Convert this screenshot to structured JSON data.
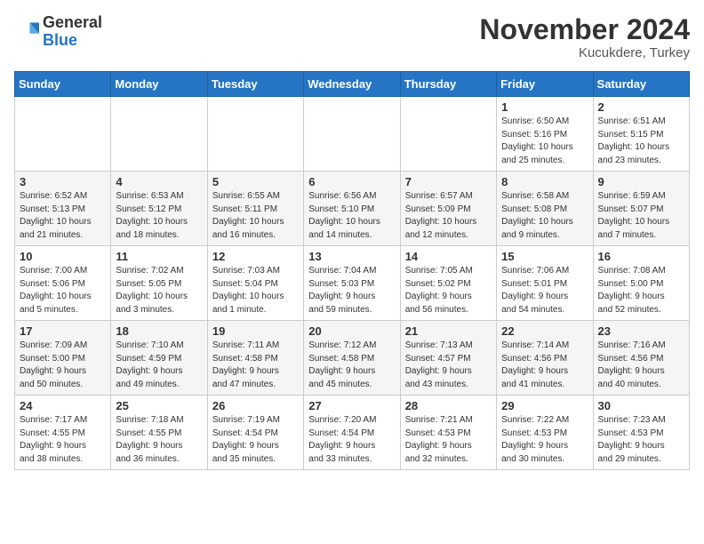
{
  "logo": {
    "general": "General",
    "blue": "Blue"
  },
  "header": {
    "month": "November 2024",
    "location": "Kucukdere, Turkey"
  },
  "days_of_week": [
    "Sunday",
    "Monday",
    "Tuesday",
    "Wednesday",
    "Thursday",
    "Friday",
    "Saturday"
  ],
  "weeks": [
    [
      {
        "day": "",
        "info": ""
      },
      {
        "day": "",
        "info": ""
      },
      {
        "day": "",
        "info": ""
      },
      {
        "day": "",
        "info": ""
      },
      {
        "day": "",
        "info": ""
      },
      {
        "day": "1",
        "info": "Sunrise: 6:50 AM\nSunset: 5:16 PM\nDaylight: 10 hours\nand 25 minutes."
      },
      {
        "day": "2",
        "info": "Sunrise: 6:51 AM\nSunset: 5:15 PM\nDaylight: 10 hours\nand 23 minutes."
      }
    ],
    [
      {
        "day": "3",
        "info": "Sunrise: 6:52 AM\nSunset: 5:13 PM\nDaylight: 10 hours\nand 21 minutes."
      },
      {
        "day": "4",
        "info": "Sunrise: 6:53 AM\nSunset: 5:12 PM\nDaylight: 10 hours\nand 18 minutes."
      },
      {
        "day": "5",
        "info": "Sunrise: 6:55 AM\nSunset: 5:11 PM\nDaylight: 10 hours\nand 16 minutes."
      },
      {
        "day": "6",
        "info": "Sunrise: 6:56 AM\nSunset: 5:10 PM\nDaylight: 10 hours\nand 14 minutes."
      },
      {
        "day": "7",
        "info": "Sunrise: 6:57 AM\nSunset: 5:09 PM\nDaylight: 10 hours\nand 12 minutes."
      },
      {
        "day": "8",
        "info": "Sunrise: 6:58 AM\nSunset: 5:08 PM\nDaylight: 10 hours\nand 9 minutes."
      },
      {
        "day": "9",
        "info": "Sunrise: 6:59 AM\nSunset: 5:07 PM\nDaylight: 10 hours\nand 7 minutes."
      }
    ],
    [
      {
        "day": "10",
        "info": "Sunrise: 7:00 AM\nSunset: 5:06 PM\nDaylight: 10 hours\nand 5 minutes."
      },
      {
        "day": "11",
        "info": "Sunrise: 7:02 AM\nSunset: 5:05 PM\nDaylight: 10 hours\nand 3 minutes."
      },
      {
        "day": "12",
        "info": "Sunrise: 7:03 AM\nSunset: 5:04 PM\nDaylight: 10 hours\nand 1 minute."
      },
      {
        "day": "13",
        "info": "Sunrise: 7:04 AM\nSunset: 5:03 PM\nDaylight: 9 hours\nand 59 minutes."
      },
      {
        "day": "14",
        "info": "Sunrise: 7:05 AM\nSunset: 5:02 PM\nDaylight: 9 hours\nand 56 minutes."
      },
      {
        "day": "15",
        "info": "Sunrise: 7:06 AM\nSunset: 5:01 PM\nDaylight: 9 hours\nand 54 minutes."
      },
      {
        "day": "16",
        "info": "Sunrise: 7:08 AM\nSunset: 5:00 PM\nDaylight: 9 hours\nand 52 minutes."
      }
    ],
    [
      {
        "day": "17",
        "info": "Sunrise: 7:09 AM\nSunset: 5:00 PM\nDaylight: 9 hours\nand 50 minutes."
      },
      {
        "day": "18",
        "info": "Sunrise: 7:10 AM\nSunset: 4:59 PM\nDaylight: 9 hours\nand 49 minutes."
      },
      {
        "day": "19",
        "info": "Sunrise: 7:11 AM\nSunset: 4:58 PM\nDaylight: 9 hours\nand 47 minutes."
      },
      {
        "day": "20",
        "info": "Sunrise: 7:12 AM\nSunset: 4:58 PM\nDaylight: 9 hours\nand 45 minutes."
      },
      {
        "day": "21",
        "info": "Sunrise: 7:13 AM\nSunset: 4:57 PM\nDaylight: 9 hours\nand 43 minutes."
      },
      {
        "day": "22",
        "info": "Sunrise: 7:14 AM\nSunset: 4:56 PM\nDaylight: 9 hours\nand 41 minutes."
      },
      {
        "day": "23",
        "info": "Sunrise: 7:16 AM\nSunset: 4:56 PM\nDaylight: 9 hours\nand 40 minutes."
      }
    ],
    [
      {
        "day": "24",
        "info": "Sunrise: 7:17 AM\nSunset: 4:55 PM\nDaylight: 9 hours\nand 38 minutes."
      },
      {
        "day": "25",
        "info": "Sunrise: 7:18 AM\nSunset: 4:55 PM\nDaylight: 9 hours\nand 36 minutes."
      },
      {
        "day": "26",
        "info": "Sunrise: 7:19 AM\nSunset: 4:54 PM\nDaylight: 9 hours\nand 35 minutes."
      },
      {
        "day": "27",
        "info": "Sunrise: 7:20 AM\nSunset: 4:54 PM\nDaylight: 9 hours\nand 33 minutes."
      },
      {
        "day": "28",
        "info": "Sunrise: 7:21 AM\nSunset: 4:53 PM\nDaylight: 9 hours\nand 32 minutes."
      },
      {
        "day": "29",
        "info": "Sunrise: 7:22 AM\nSunset: 4:53 PM\nDaylight: 9 hours\nand 30 minutes."
      },
      {
        "day": "30",
        "info": "Sunrise: 7:23 AM\nSunset: 4:53 PM\nDaylight: 9 hours\nand 29 minutes."
      }
    ]
  ]
}
